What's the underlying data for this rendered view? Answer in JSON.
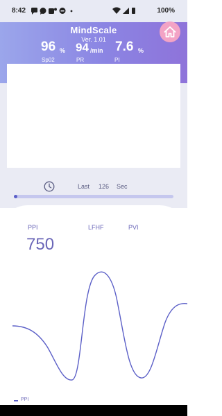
{
  "status_bar": {
    "time": "8:42",
    "battery": "100%"
  },
  "app": {
    "title": "MindScale",
    "version": "Ver. 1.01"
  },
  "metrics": [
    {
      "value": "96",
      "unit": "%",
      "label": "Sp02"
    },
    {
      "value": "94",
      "unit": "/min",
      "label": "PR"
    },
    {
      "value": "7.6",
      "unit": "%",
      "label": "PI"
    }
  ],
  "timer": {
    "prefix": "Last",
    "seconds": "126",
    "suffix": "Sec",
    "progress": 0.02
  },
  "tabs": [
    "PPI",
    "LFHF",
    "PVI"
  ],
  "selected_value": "750",
  "legend_label": "PPI",
  "colors": {
    "accent": "#5b5fc7",
    "home_button": "#f3a3c5",
    "header_start": "#9ba6eb",
    "header_end": "#8e73da",
    "panel": "#eaebf4"
  }
}
